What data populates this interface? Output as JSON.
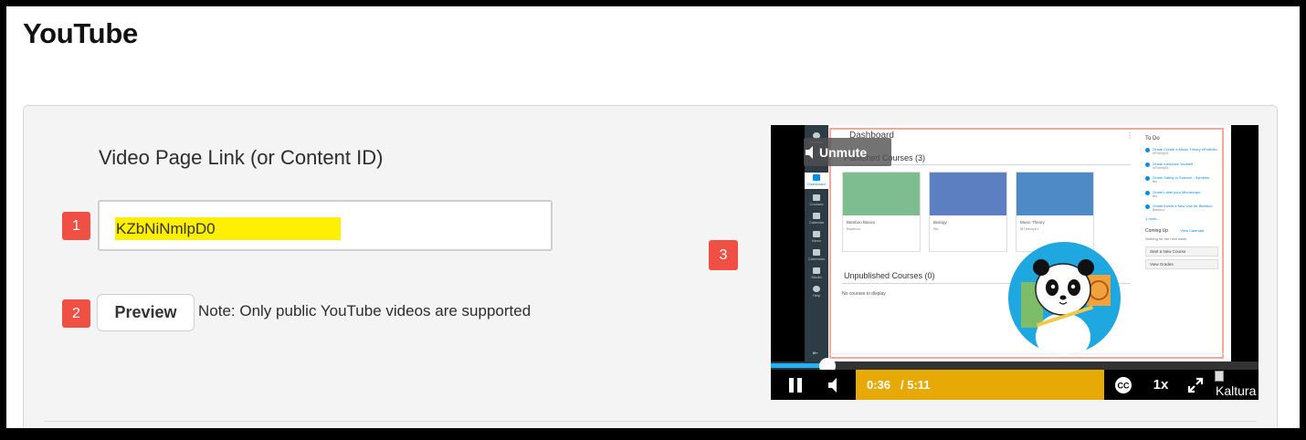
{
  "page": {
    "title": "YouTube"
  },
  "form": {
    "label": "Video Page Link (or Content ID)",
    "input_value": "KZbNiNmlpD0",
    "preview_label": "Preview",
    "note": "Note: Only public YouTube videos are supported"
  },
  "badges": {
    "one": "1",
    "two": "2",
    "three": "3"
  },
  "player": {
    "unmute_label": "Unmute",
    "current_time": "0:36",
    "total_time": "/ 5:11",
    "progress": 0.116,
    "speed": "1x",
    "cc_label": "CC",
    "brand": "Kaltura",
    "colors": {
      "control_accent": "#e6a906",
      "progress": "#1fb3ff"
    },
    "icons": [
      "pause-icon",
      "volume-icon",
      "closed-captions-icon",
      "fullscreen-icon",
      "speaker-icon"
    ]
  },
  "video_frame": {
    "dashboard_title": "Dashboard",
    "published_heading": "Published Courses (3)",
    "unpublished_heading": "Unpublished Courses (0)",
    "no_courses": "No courses to display",
    "nav": [
      {
        "label": "Account"
      },
      {
        "label": "Dashboard"
      },
      {
        "label": "Courses"
      },
      {
        "label": "Calendar"
      },
      {
        "label": "Inbox"
      },
      {
        "label": "Commons"
      },
      {
        "label": "Studio"
      },
      {
        "label": "Help"
      }
    ],
    "courses": [
      {
        "name": "Bamboo Basics",
        "sub": "Bamboo",
        "color": "#7dbd8f"
      },
      {
        "name": "Biology",
        "sub": "Bio",
        "color": "#5b7fc0"
      },
      {
        "name": "Music Theory",
        "sub": "MTheory01",
        "color": "#4e8ac6"
      }
    ],
    "todo": {
      "heading": "To Do",
      "items": [
        {
          "title": "Grade Create a Music Theory ePortfolio",
          "meta": "MTheory01"
        },
        {
          "title": "Grade Introduce Yourself",
          "meta": "MTheory01"
        },
        {
          "title": "Grade Safety in Science - Symbols",
          "meta": "Bio"
        },
        {
          "title": "Grade Label your Microscope",
          "meta": "Bio"
        },
        {
          "title": "Grade Invent a New Use for Bamboo",
          "meta": "Bamboo"
        }
      ],
      "more": "1 more...",
      "coming_up": "Coming Up",
      "view_calendar": "View Calendar",
      "nothing": "Nothing for the next week",
      "start_course": "Start a New Course",
      "view_grades": "View Grades"
    }
  }
}
